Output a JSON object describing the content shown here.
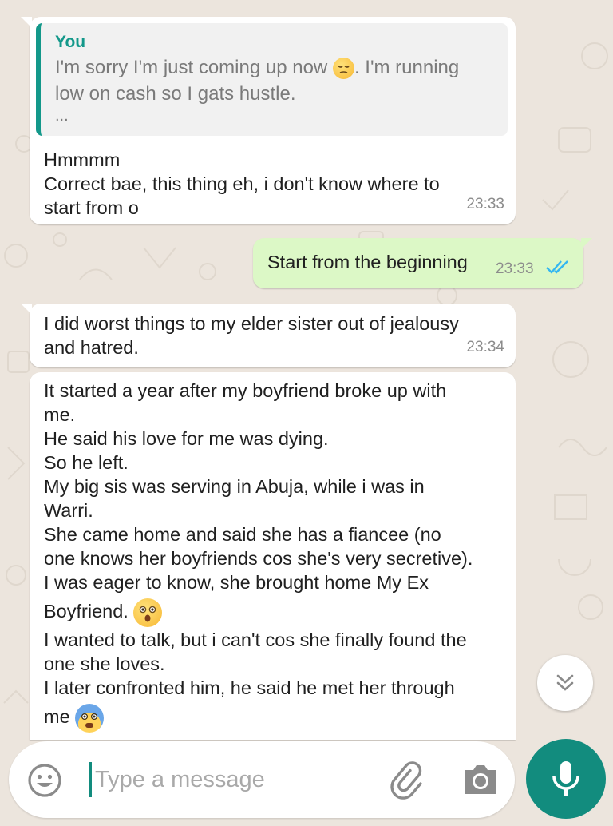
{
  "chat": {
    "quoted": {
      "author": "You",
      "line1": "I'm sorry I'm just coming up now",
      "line1_end": ". I'm running",
      "line2": "low on cash so I gats hustle.",
      "ellipsis": "..."
    },
    "m1": {
      "line1": "Hmmmm",
      "line2": "Correct bae, this thing eh, i don't know where to",
      "line3": "start from o",
      "time": "23:33"
    },
    "m2": {
      "text": "Start from the beginning",
      "time": "23:33"
    },
    "m3": {
      "line1": "I did worst things to my elder sister out of jealousy",
      "line2": "and hatred.",
      "time": "23:34"
    },
    "m4": {
      "lines": [
        "It started a year after my boyfriend broke up with",
        "me.",
        "He said his love for me was dying.",
        "So he left.",
        "My big sis was serving in Abuja, while i was in",
        "Warri.",
        "She came home and said she has a fiancee  (no",
        "one knows her boyfriends cos she's very secretive).",
        "I was eager to know, she brought home My Ex",
        "Boyfriend.",
        "I wanted to talk, but i can't cos she finally found the",
        "one she loves.",
        "I later confronted him, he said he met her through",
        "me"
      ]
    }
  },
  "input": {
    "placeholder": "Type a message"
  },
  "icons": {
    "emoji": "smiley-icon",
    "attach": "paperclip-icon",
    "camera": "camera-icon",
    "mic": "microphone-icon",
    "scroll": "chevron-double-down-icon",
    "read": "double-check-icon"
  },
  "colors": {
    "wallpaper": "#ece5dd",
    "outgoing_bubble": "#dcf8c6",
    "accent": "#128c7e",
    "read_ticks": "#34b7f1",
    "quote_author": "#13988a"
  }
}
